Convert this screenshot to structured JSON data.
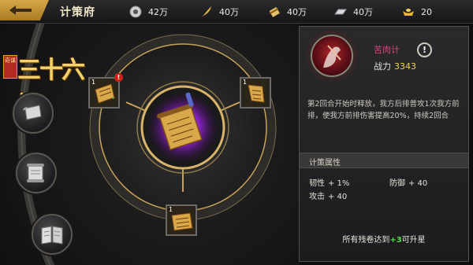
{
  "header": {
    "title": "计策府",
    "currencies": [
      {
        "icon": "silver-coin-icon",
        "value": "42万"
      },
      {
        "icon": "feather-icon",
        "value": "40万"
      },
      {
        "icon": "scroll-icon",
        "value": "40万"
      },
      {
        "icon": "iron-ingot-icon",
        "value": "40万"
      },
      {
        "icon": "gold-ingot-icon",
        "value": "20"
      }
    ]
  },
  "logo": {
    "seal": "奇谋",
    "text": "三十六计"
  },
  "sidebar": {
    "buttons": [
      {
        "icon": "scroll-icon"
      },
      {
        "icon": "open-scroll-icon"
      },
      {
        "icon": "book-icon"
      }
    ]
  },
  "wheel": {
    "slots": [
      {
        "position": "left",
        "count": "1",
        "alert": "!"
      },
      {
        "position": "right",
        "count": "1"
      },
      {
        "position": "bottom",
        "count": "1"
      }
    ]
  },
  "skill": {
    "name": "苦肉计",
    "power_label": "战力",
    "power_value": "3343",
    "info_symbol": "!",
    "description": "第2回合开始时释放，我方后排普攻1次我方前排，使我方前排伤害提高20%，持续2回合",
    "attributes_header": "计策属性",
    "attributes": [
      {
        "name": "韧性",
        "value": "+ 1%"
      },
      {
        "name": "防御",
        "value": "+ 40"
      },
      {
        "name": "攻击",
        "value": "+ 40"
      }
    ],
    "footer_prefix": "所有残卷达到",
    "footer_highlight": "+3",
    "footer_suffix": "可升星"
  },
  "colors": {
    "accent_gold": "#d6a84a",
    "skill_name": "#e0407a",
    "power_value": "#f2d25c",
    "highlight_green": "#54e04a"
  }
}
